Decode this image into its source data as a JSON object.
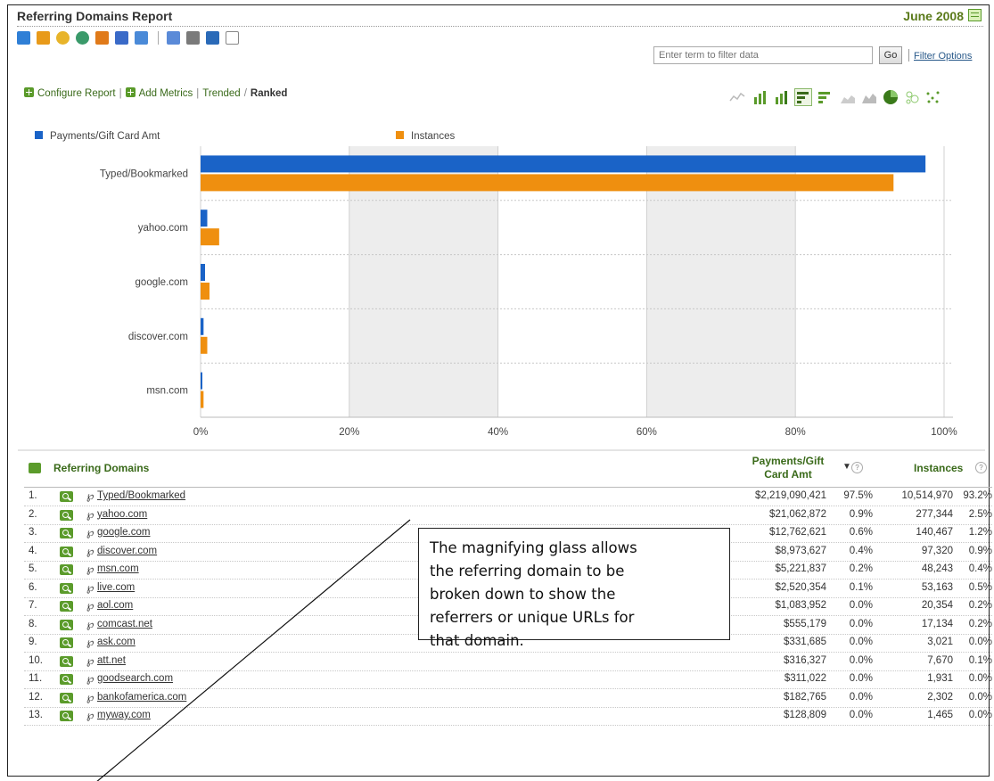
{
  "header": {
    "title": "Referring Domains Report",
    "date": "June 2008"
  },
  "toolbar": {
    "icons": [
      "save-icon",
      "email-icon",
      "bookmark-icon",
      "dashboard-icon",
      "alert-icon",
      "list-icon",
      "target-icon",
      "edit-icon",
      "print-icon",
      "download-icon",
      "grid-icon"
    ],
    "filter_placeholder": "Enter term to filter data",
    "go_label": "Go",
    "filter_options_label": "Filter Options"
  },
  "config_bar": {
    "configure_label": "Configure Report",
    "add_metrics_label": "Add Metrics",
    "trended_label": "Trended",
    "ranked_label": "Ranked",
    "sep_pipe": "|",
    "sep_slash": "/"
  },
  "chart_types": [
    "line-chart-icon",
    "vertical-bar-icon",
    "stacked-vertical-bar-icon",
    "horizontal-bar-icon",
    "stacked-horizontal-bar-icon",
    "area-chart-icon",
    "stacked-area-icon",
    "pie-chart-icon",
    "bubble-icon",
    "scatter-icon"
  ],
  "colors": {
    "series1": "#1a63c7",
    "series2": "#ef8f0f",
    "accent": "#3a6a1a"
  },
  "chart_data": {
    "type": "bar",
    "orientation": "horizontal",
    "categories": [
      "Typed/Bookmarked",
      "yahoo.com",
      "google.com",
      "discover.com",
      "msn.com"
    ],
    "series": [
      {
        "name": "Payments/Gift Card Amt",
        "values": [
          97.5,
          0.9,
          0.6,
          0.4,
          0.2
        ]
      },
      {
        "name": "Instances",
        "values": [
          93.2,
          2.5,
          1.2,
          0.9,
          0.4
        ]
      }
    ],
    "xlim": [
      0,
      100
    ],
    "x_ticks": [
      "0%",
      "20%",
      "40%",
      "60%",
      "80%",
      "100%"
    ],
    "legend_position": "top"
  },
  "table": {
    "header": {
      "label": "Referring Domains",
      "payments": "Payments/Gift Card Amt",
      "instances": "Instances",
      "sort_indicator": "▼",
      "help": "?"
    },
    "rows": [
      {
        "num": "1.",
        "domain": "Typed/Bookmarked",
        "payments": "$2,219,090,421",
        "payments_pct": "97.5%",
        "instances": "10,514,970",
        "instances_pct": "93.2%"
      },
      {
        "num": "2.",
        "domain": "yahoo.com",
        "payments": "$21,062,872",
        "payments_pct": "0.9%",
        "instances": "277,344",
        "instances_pct": "2.5%"
      },
      {
        "num": "3.",
        "domain": "google.com",
        "payments": "$12,762,621",
        "payments_pct": "0.6%",
        "instances": "140,467",
        "instances_pct": "1.2%"
      },
      {
        "num": "4.",
        "domain": "discover.com",
        "payments": "$8,973,627",
        "payments_pct": "0.4%",
        "instances": "97,320",
        "instances_pct": "0.9%"
      },
      {
        "num": "5.",
        "domain": "msn.com",
        "payments": "$5,221,837",
        "payments_pct": "0.2%",
        "instances": "48,243",
        "instances_pct": "0.4%"
      },
      {
        "num": "6.",
        "domain": "live.com",
        "payments": "$2,520,354",
        "payments_pct": "0.1%",
        "instances": "53,163",
        "instances_pct": "0.5%"
      },
      {
        "num": "7.",
        "domain": "aol.com",
        "payments": "$1,083,952",
        "payments_pct": "0.0%",
        "instances": "20,354",
        "instances_pct": "0.2%"
      },
      {
        "num": "8.",
        "domain": "comcast.net",
        "payments": "$555,179",
        "payments_pct": "0.0%",
        "instances": "17,134",
        "instances_pct": "0.2%"
      },
      {
        "num": "9.",
        "domain": "ask.com",
        "payments": "$331,685",
        "payments_pct": "0.0%",
        "instances": "3,021",
        "instances_pct": "0.0%"
      },
      {
        "num": "10.",
        "domain": "att.net",
        "payments": "$316,327",
        "payments_pct": "0.0%",
        "instances": "7,670",
        "instances_pct": "0.1%"
      },
      {
        "num": "11.",
        "domain": "goodsearch.com",
        "payments": "$311,022",
        "payments_pct": "0.0%",
        "instances": "1,931",
        "instances_pct": "0.0%"
      },
      {
        "num": "12.",
        "domain": "bankofamerica.com",
        "payments": "$182,765",
        "payments_pct": "0.0%",
        "instances": "2,302",
        "instances_pct": "0.0%"
      },
      {
        "num": "13.",
        "domain": "myway.com",
        "payments": "$128,809",
        "payments_pct": "0.0%",
        "instances": "1,465",
        "instances_pct": "0.0%"
      }
    ]
  },
  "callout": {
    "lines": [
      "The magnifying  glass allows",
      "the referring domain to be",
      "broken down to show the",
      "referrers or unique  URLs for",
      "that domain."
    ]
  }
}
